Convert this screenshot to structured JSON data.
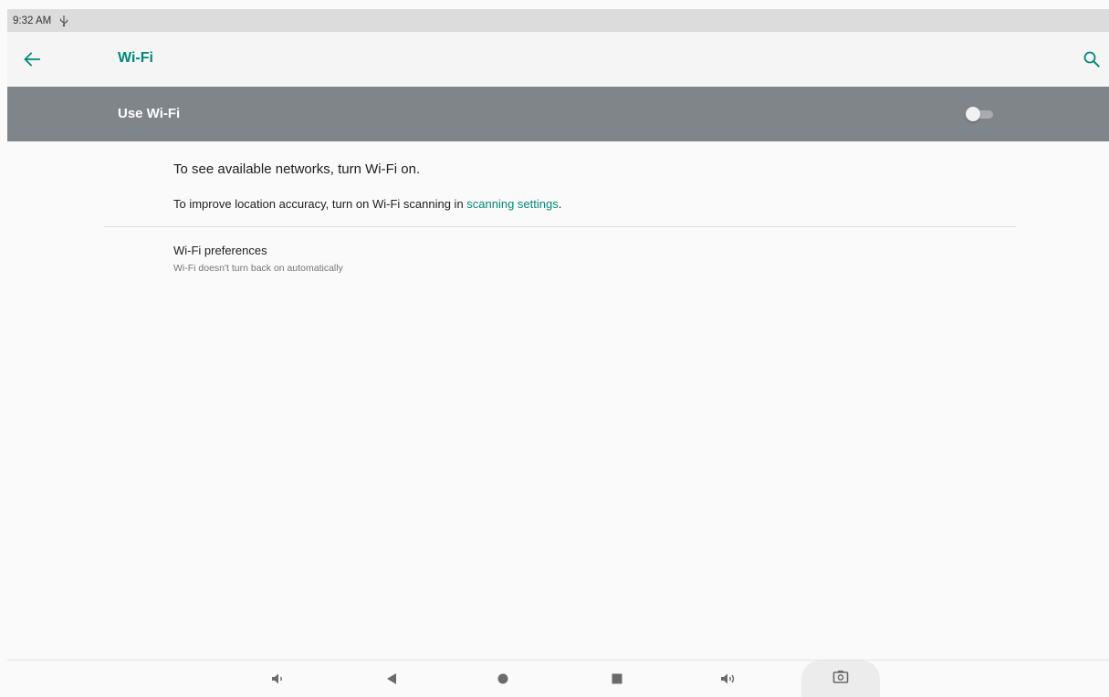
{
  "status_bar": {
    "time": "9:32 AM",
    "icons": [
      "usb-icon"
    ]
  },
  "app_bar": {
    "title": "Wi-Fi",
    "back_icon": "arrow-back-icon",
    "search_icon": "search-icon"
  },
  "master_switch": {
    "label": "Use Wi-Fi",
    "enabled": false
  },
  "empty_state": {
    "title": "To see available networks, turn Wi-Fi on.",
    "hint_prefix": "To improve location accuracy, turn on Wi-Fi scanning in ",
    "hint_link": "scanning settings",
    "hint_suffix": "."
  },
  "preferences": {
    "title": "Wi-Fi preferences",
    "summary": "Wi-Fi doesn't turn back on automatically"
  },
  "nav_bar": {
    "buttons": [
      "volume-down-icon",
      "back-icon",
      "home-icon",
      "recents-icon",
      "volume-up-icon",
      "screenshot-icon"
    ]
  },
  "colors": {
    "accent": "#00897b",
    "switch_bar": "#80858a",
    "background": "#fafafa"
  }
}
